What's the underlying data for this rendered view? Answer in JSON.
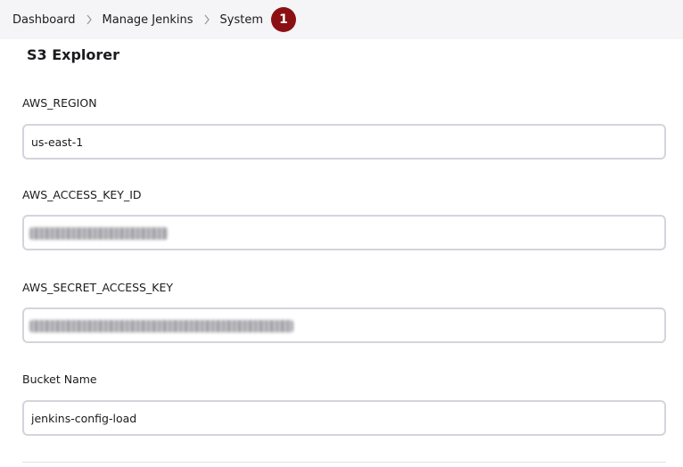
{
  "breadcrumb": {
    "items": [
      "Dashboard",
      "Manage Jenkins",
      "System"
    ],
    "badge_count": "1"
  },
  "section": {
    "title": "S3 Explorer"
  },
  "fields": {
    "aws_region": {
      "label": "AWS_REGION",
      "value": "us-east-1"
    },
    "aws_access_key_id": {
      "label": "AWS_ACCESS_KEY_ID",
      "value": ""
    },
    "aws_secret_access_key": {
      "label": "AWS_SECRET_ACCESS_KEY",
      "value": ""
    },
    "bucket_name": {
      "label": "Bucket Name",
      "value": "jenkins-config-load"
    }
  },
  "colors": {
    "badge_bg": "#8b1014",
    "breadcrumb_bg": "#f5f5f7",
    "input_border": "#d4d4dc"
  },
  "icons": {
    "separator": "chevron-right-icon"
  }
}
